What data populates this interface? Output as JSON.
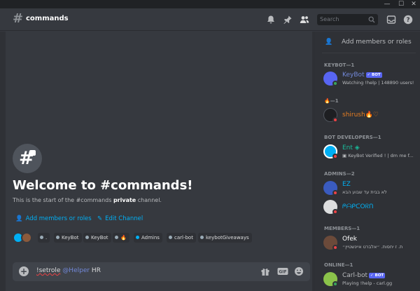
{
  "window_controls": {
    "minimize": "—",
    "maximize": "☐",
    "close": "✕"
  },
  "header": {
    "channel_hash": "#",
    "channel_name": "commands",
    "search_placeholder": "Search"
  },
  "welcome": {
    "title": "Welcome to #commands!",
    "subtitle_prefix": "This is the start of the #commands ",
    "subtitle_bold": "private",
    "subtitle_suffix": " channel.",
    "add_members_label": "Add members or roles",
    "edit_channel_label": "Edit Channel"
  },
  "roles_row": [
    {
      "label": "."
    },
    {
      "label": "KeyBot"
    },
    {
      "label": "KeyBot"
    },
    {
      "label": "🔥"
    },
    {
      "label": "Admins"
    },
    {
      "label": "carl-bot"
    },
    {
      "label": "keybotGiveaways"
    }
  ],
  "composer": {
    "command": "!setrole",
    "mention": "@Helper",
    "rest": " HR"
  },
  "members": {
    "add_label": "Add members or roles",
    "groups": [
      {
        "category": "KEYBOT—1",
        "members": [
          {
            "name": "KeyBot",
            "bot": "✓ BOT",
            "activity": "Watching !help | 148890 users!",
            "name_color": "#7289da",
            "status": "online"
          }
        ]
      },
      {
        "category": "🔥—1",
        "members": [
          {
            "name": "shirush🔥♡",
            "bot": "",
            "activity": "",
            "name_color": "#e67e22",
            "status": "dnd"
          }
        ]
      },
      {
        "category": "BOT DEVELOPERS—1",
        "members": [
          {
            "name": "Ent ◈",
            "bot": "",
            "activity": "▣ KeyBot Verified ! | dm me f...",
            "name_color": "#1abc9c",
            "status": "dnd"
          }
        ]
      },
      {
        "category": "ADMINS—2",
        "members": [
          {
            "name": "EZ",
            "bot": "",
            "activity": "לא בבית עד שבוע הבא",
            "name_color": "#00b0f4",
            "status": "dnd"
          },
          {
            "name": "ᖘᗩᑭᑕOᖇᑎ",
            "bot": "",
            "activity": "",
            "name_color": "#00b0f4",
            "status": "dnd"
          }
        ]
      },
      {
        "category": "MEMBERS—1",
        "members": [
          {
            "name": "Ofek",
            "bot": "",
            "activity": "ת. ז יחסות. ״אלברט איינשטיין״",
            "name_color": "#ffffff",
            "status": "dnd"
          }
        ]
      },
      {
        "category": "ONLINE—1",
        "members": [
          {
            "name": "Carl-bot",
            "bot": "✓ BOT",
            "activity": "Playing !help - carl.gg",
            "name_color": "#b9bbbe",
            "status": "online"
          }
        ]
      }
    ]
  },
  "colors": {
    "background": "#36393f",
    "sidebar": "#2f3136",
    "accent_link": "#00aff4",
    "mention": "#7289da",
    "online": "#3ba55c",
    "dnd": "#ed4245"
  }
}
